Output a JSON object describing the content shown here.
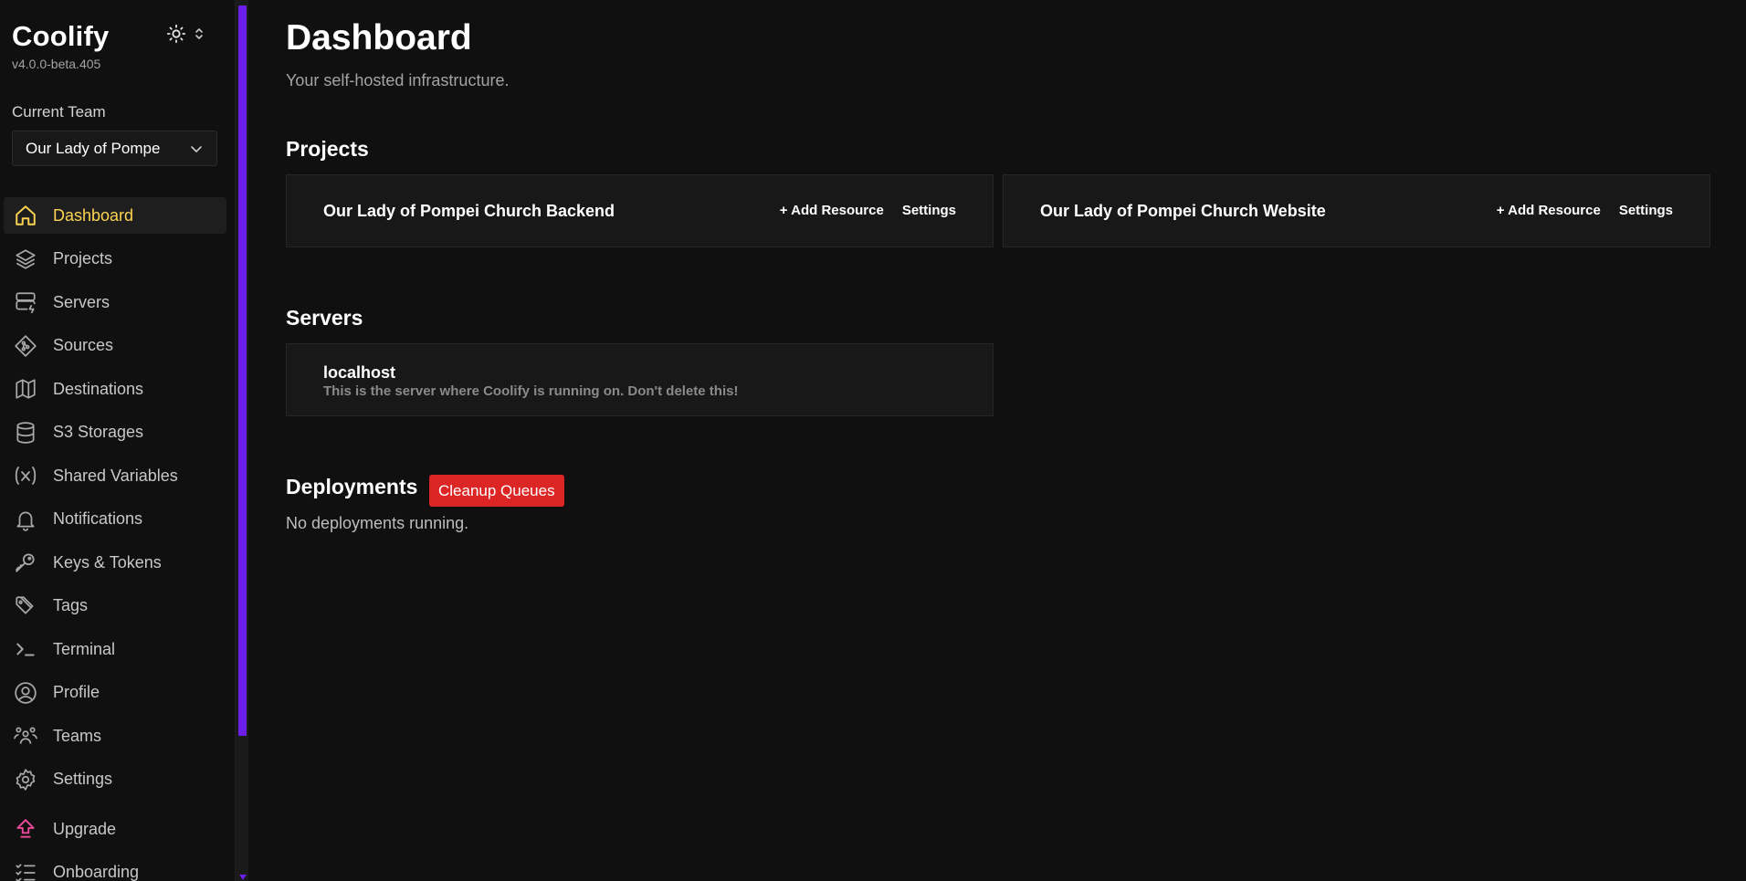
{
  "app": {
    "name": "Coolify",
    "version": "v4.0.0-beta.405"
  },
  "theme_toggle": {
    "icon": "sun-icon",
    "chevron": "chevron-up-down-icon"
  },
  "team": {
    "label": "Current Team",
    "selected": "Our Lady of Pompe"
  },
  "sidebar": {
    "items": [
      {
        "label": "Dashboard",
        "icon": "home-icon",
        "active": true
      },
      {
        "label": "Projects",
        "icon": "layers-icon"
      },
      {
        "label": "Servers",
        "icon": "server-icon"
      },
      {
        "label": "Sources",
        "icon": "git-icon"
      },
      {
        "label": "Destinations",
        "icon": "map-icon"
      },
      {
        "label": "S3 Storages",
        "icon": "database-icon"
      },
      {
        "label": "Shared Variables",
        "icon": "variable-icon"
      },
      {
        "label": "Notifications",
        "icon": "bell-icon"
      },
      {
        "label": "Keys & Tokens",
        "icon": "key-icon"
      },
      {
        "label": "Tags",
        "icon": "tag-icon"
      },
      {
        "label": "Terminal",
        "icon": "terminal-icon"
      },
      {
        "label": "Profile",
        "icon": "user-circle-icon"
      },
      {
        "label": "Teams",
        "icon": "users-icon"
      },
      {
        "label": "Settings",
        "icon": "gear-icon"
      }
    ],
    "upgrade": {
      "label": "Upgrade",
      "icon": "upgrade-icon",
      "color": "#ec4899"
    },
    "onboarding": {
      "label": "Onboarding",
      "icon": "checklist-icon"
    }
  },
  "colors": {
    "accent_active": "#fcd452",
    "scrollbar": "#6b1fe8",
    "danger": "#dc2626",
    "background": "#101010",
    "card": "#181818"
  },
  "main": {
    "title": "Dashboard",
    "subtitle": "Your self-hosted infrastructure.",
    "projects": {
      "title": "Projects",
      "items": [
        {
          "name": "Our Lady of Pompei Church Backend",
          "add": "+ Add Resource",
          "settings": "Settings"
        },
        {
          "name": "Our Lady of Pompei Church Website",
          "add": "+ Add Resource",
          "settings": "Settings"
        }
      ]
    },
    "servers": {
      "title": "Servers",
      "items": [
        {
          "name": "localhost",
          "description": "This is the server where Coolify is running on. Don't delete this!"
        }
      ]
    },
    "deployments": {
      "title": "Deployments",
      "cleanup_label": "Cleanup Queues",
      "empty_text": "No deployments running."
    }
  }
}
